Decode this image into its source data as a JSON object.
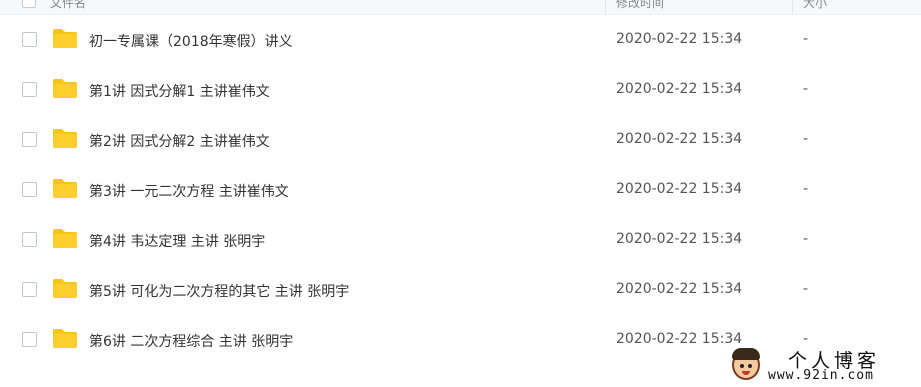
{
  "header": {
    "name_label": "文件名",
    "modified_label": "修改时间",
    "size_label": "大小"
  },
  "files": [
    {
      "name": "初一专属课（2018年寒假）讲义",
      "modified": "2020-02-22 15:34",
      "size": "-"
    },
    {
      "name": "第1讲 因式分解1  主讲崔伟文",
      "modified": "2020-02-22 15:34",
      "size": "-"
    },
    {
      "name": "第2讲 因式分解2  主讲崔伟文",
      "modified": "2020-02-22 15:34",
      "size": "-"
    },
    {
      "name": "第3讲 一元二次方程  主讲崔伟文",
      "modified": "2020-02-22 15:34",
      "size": "-"
    },
    {
      "name": "第4讲 韦达定理  主讲 张明宇",
      "modified": "2020-02-22 15:34",
      "size": "-"
    },
    {
      "name": "第5讲 可化为二次方程的其它  主讲 张明宇",
      "modified": "2020-02-22 15:34",
      "size": "-"
    },
    {
      "name": "第6讲 二次方程综合  主讲 张明宇",
      "modified": "2020-02-22 15:34",
      "size": "-"
    }
  ],
  "icons": {
    "folder": "folder-icon",
    "folder_color": "#f5c518"
  },
  "watermark": {
    "title": "个人博客",
    "url": "www.92in.com"
  }
}
